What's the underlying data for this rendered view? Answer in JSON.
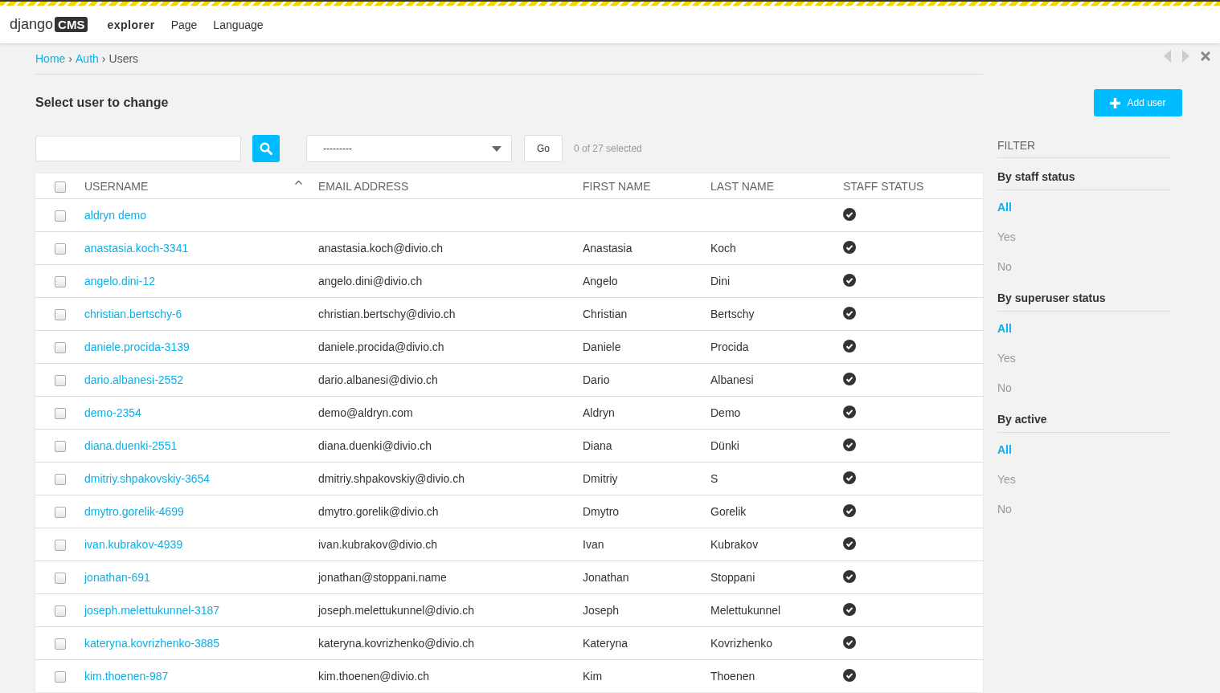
{
  "toolbar": {
    "logo_text": "django",
    "logo_badge": "CMS",
    "menu": [
      {
        "label": "explorer",
        "selected": true
      },
      {
        "label": "Page",
        "selected": false
      },
      {
        "label": "Language",
        "selected": false
      }
    ]
  },
  "breadcrumbs": [
    {
      "label": "Home",
      "link": true
    },
    {
      "label": "Auth",
      "link": true
    },
    {
      "label": "Users",
      "link": false
    }
  ],
  "breadcrumb_separator": "›",
  "title": "Select user to change",
  "add_button": "Add user",
  "action_select": {
    "value": "---------"
  },
  "go_button": "Go",
  "selection_counter": "0 of 27 selected",
  "table": {
    "columns": [
      {
        "label": "USERNAME",
        "sorted": true
      },
      {
        "label": "EMAIL ADDRESS",
        "sorted": false
      },
      {
        "label": "FIRST NAME",
        "sorted": false
      },
      {
        "label": "LAST NAME",
        "sorted": false
      },
      {
        "label": "STAFF STATUS",
        "sorted": false
      }
    ],
    "select_all_checked": false,
    "rows": [
      {
        "username": "aldryn demo",
        "email": "",
        "first_name": "",
        "last_name": "",
        "staff": true,
        "checked": false
      },
      {
        "username": "anastasia.koch-3341",
        "email": "anastasia.koch@divio.ch",
        "first_name": "Anastasia",
        "last_name": "Koch",
        "staff": true,
        "checked": false
      },
      {
        "username": "angelo.dini-12",
        "email": "angelo.dini@divio.ch",
        "first_name": "Angelo",
        "last_name": "Dini",
        "staff": true,
        "checked": false
      },
      {
        "username": "christian.bertschy-6",
        "email": "christian.bertschy@divio.ch",
        "first_name": "Christian",
        "last_name": "Bertschy",
        "staff": true,
        "checked": false
      },
      {
        "username": "daniele.procida-3139",
        "email": "daniele.procida@divio.ch",
        "first_name": "Daniele",
        "last_name": "Procida",
        "staff": true,
        "checked": false
      },
      {
        "username": "dario.albanesi-2552",
        "email": "dario.albanesi@divio.ch",
        "first_name": "Dario",
        "last_name": "Albanesi",
        "staff": true,
        "checked": false
      },
      {
        "username": "demo-2354",
        "email": "demo@aldryn.com",
        "first_name": "Aldryn",
        "last_name": "Demo",
        "staff": true,
        "checked": false
      },
      {
        "username": "diana.duenki-2551",
        "email": "diana.duenki@divio.ch",
        "first_name": "Diana",
        "last_name": "Dünki",
        "staff": true,
        "checked": false
      },
      {
        "username": "dmitriy.shpakovskiy-3654",
        "email": "dmitriy.shpakovskiy@divio.ch",
        "first_name": "Dmitriy",
        "last_name": "S",
        "staff": true,
        "checked": false
      },
      {
        "username": "dmytro.gorelik-4699",
        "email": "dmytro.gorelik@divio.ch",
        "first_name": "Dmytro",
        "last_name": "Gorelik",
        "staff": true,
        "checked": false
      },
      {
        "username": "ivan.kubrakov-4939",
        "email": "ivan.kubrakov@divio.ch",
        "first_name": "Ivan",
        "last_name": "Kubrakov",
        "staff": true,
        "checked": false
      },
      {
        "username": "jonathan-691",
        "email": "jonathan@stoppani.name",
        "first_name": "Jonathan",
        "last_name": "Stoppani",
        "staff": true,
        "checked": false
      },
      {
        "username": "joseph.melettukunnel-3187",
        "email": "joseph.melettukunnel@divio.ch",
        "first_name": "Joseph",
        "last_name": "Melettukunnel",
        "staff": true,
        "checked": false
      },
      {
        "username": "kateryna.kovrizhenko-3885",
        "email": "kateryna.kovrizhenko@divio.ch",
        "first_name": "Kateryna",
        "last_name": "Kovrizhenko",
        "staff": true,
        "checked": false
      },
      {
        "username": "kim.thoenen-987",
        "email": "kim.thoenen@divio.ch",
        "first_name": "Kim",
        "last_name": "Thoenen",
        "staff": true,
        "checked": false
      }
    ]
  },
  "filter": {
    "title": "FILTER",
    "groups": [
      {
        "title": "By staff status",
        "options": [
          {
            "label": "All",
            "selected": true
          },
          {
            "label": "Yes",
            "selected": false
          },
          {
            "label": "No",
            "selected": false
          }
        ]
      },
      {
        "title": "By superuser status",
        "options": [
          {
            "label": "All",
            "selected": true
          },
          {
            "label": "Yes",
            "selected": false
          },
          {
            "label": "No",
            "selected": false
          }
        ]
      },
      {
        "title": "By active",
        "options": [
          {
            "label": "All",
            "selected": true
          },
          {
            "label": "Yes",
            "selected": false
          },
          {
            "label": "No",
            "selected": false
          }
        ]
      }
    ]
  }
}
